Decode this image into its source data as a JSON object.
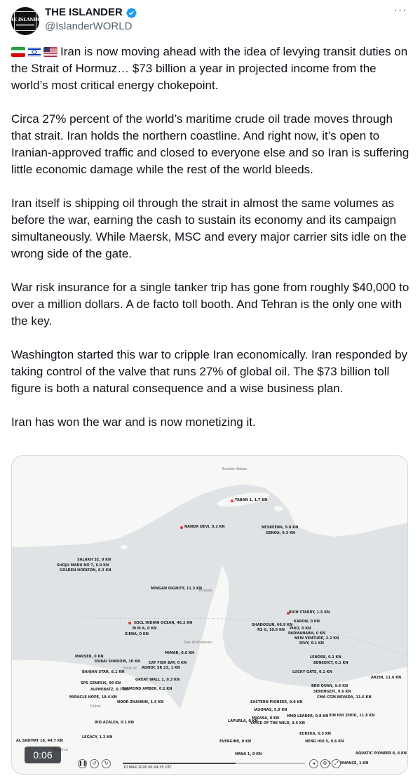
{
  "author": {
    "display_name": "THE ISLANDER",
    "handle": "@IslanderWORLD",
    "avatar_text": "THE ISLANDER"
  },
  "more_label": "···",
  "tweet": {
    "paragraphs": [
      "Iran is now moving ahead with the idea of levying transit duties on the Strait of Hormuz…  $73 billion a year in projected income from the world’s most critical energy chokepoint.",
      "Circa 27% percent of the world’s maritime crude oil trade moves through that strait.  Iran holds the northern coastline. And right now, it’s open to Iranian-approved traffic and closed to everyone else and so Iran is suffering little economic damage while the rest of the world bleeds.",
      "Iran itself is shipping oil through the strait in almost the same volumes as before the war, earning the cash to sustain its economy and its campaign simultaneously.  While Maersk, MSC and every major carrier sits idle on the\nwrong side of the gate.",
      "War risk insurance for a single tanker trip has gone from roughly $40,000 to over a million dollars.  A de facto toll booth. And Tehran is the only one with the key.",
      "Washington started this war to cripple Iran economically. Iran responded by taking control of the valve that runs 27% of global oil. The $73 billion toll figure is both a natural consequence and a wise business plan.",
      "Iran has won the war and is now monetizing it."
    ]
  },
  "video": {
    "timer": "0:06",
    "datestamp": "10 MAR 2026 00:24:35 UTC",
    "progress": 0.62,
    "map_labels": {
      "bandar_abbas": "Bandar Abbas",
      "khasab": "Khasab",
      "dubai": "Dubai",
      "ras_al_khaimah": "Ras Al Khaimah",
      "ganthut": "Ganthut",
      "sharjah_region": "Umm Al",
      "ships": [
        "TABAN 1, 1.7 KN",
        "NANDA DEVI, 0.2 KN",
        "NESREENA, 9.8 KN",
        "GENOA, 9.3 KN",
        "SALAKH 32, 0 KN",
        "SHOJU MARU NO 7, 6.9 KN",
        "GOLDEN HORIZON, 8.3 KN",
        "MINGAN DIGNITY, 11.3 KN",
        "RICH STARRY, 1.5 KN",
        "GSCL INDIAN OCEAN, 46.2 KN",
        "M M A, 0 KN",
        "SIENA, 0 KN",
        "SHADOGUN, 66.9 KN",
        "RS G, 10.6 KN",
        "KARON, 0 KN",
        "PIRO, 0 KN",
        "PADMANABH, 0 KN",
        "NEW VENTURE, 2.2 KN",
        "DIVY, 0.1 KN",
        "MARSER, 0 KN",
        "DUBAI SHADOW, 10 KN",
        "MIMAR, 0.6 KN",
        "CAT FISH BAY, 0 KN",
        "ADNOC SR 23, 1 KN",
        "LENORE, 0.1 KN",
        "BENEDICT, 0.1 KN",
        "BAHJAN STAR, 8.1 KN",
        "LUCKY GATE, 0.1 KN",
        "GREAT WALL 1, 0.3 KN",
        "ARZIN, 11.6 KN",
        "SPS GENESIS, 99 KN",
        "ALPHEBATZ, 0.7 KN",
        "DIAMOND AMBER, 0.1 KN",
        "MIRACLE HOPE, 18.4 KN",
        "BRO QUAN, 9.6 KN",
        "SERENGETI, 9.6 KN",
        "CMA CGM NEVADA, 11.6 KN",
        "NOOR ZHAHBIN, 1.5 KN",
        "EASTERN PIONEER, 9.8 KN",
        "IASONAS, 5.9 KN",
        "RIO AZALEA, 0.1 KN",
        "LAPURLA, 0 KN",
        "MIKASA, 0 KN",
        "VOICE OF THE WILD, 9.5 KN",
        "HMD LEADER, 0.8 KN",
        "XIN HUI ZHOU, 11.8 KN",
        "AL SADIYAT 16, 44.7 KN",
        "LEGACY, 1.2 KN",
        "EVERGINE, 0 KN",
        "EUREKA, 0.5 KN",
        "HENG HUI 5, 0.6 KN",
        "HANA 1, 0 KN",
        "AQUATIC PIONEER 8, 4 KN",
        "OBAL DOMINANCE, 1 KN"
      ]
    }
  },
  "colors": {
    "handle": "#536471",
    "verified": "#1d9bf0",
    "land": "#f7f7f5",
    "water": "#dfe3e6",
    "ship_red": "#e53935",
    "ship_green": "#4caf50"
  }
}
